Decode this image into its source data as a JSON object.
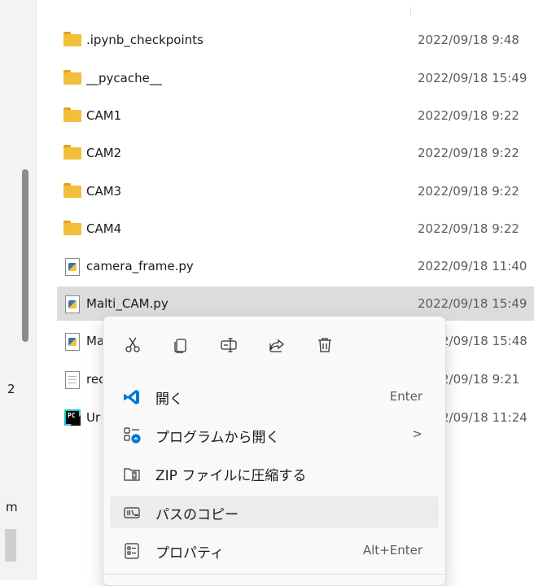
{
  "left_edge": {
    "row_text_a": "2",
    "row_text_b": "m"
  },
  "files": [
    {
      "name": ".ipynb_checkpoints",
      "date": "2022/09/18 9:48",
      "icon": "folder-icon"
    },
    {
      "name": "__pycache__",
      "date": "2022/09/18 15:49",
      "icon": "folder-icon"
    },
    {
      "name": "CAM1",
      "date": "2022/09/18 9:22",
      "icon": "folder-icon"
    },
    {
      "name": "CAM2",
      "date": "2022/09/18 9:22",
      "icon": "folder-icon"
    },
    {
      "name": "CAM3",
      "date": "2022/09/18 9:22",
      "icon": "folder-icon"
    },
    {
      "name": "CAM4",
      "date": "2022/09/18 9:22",
      "icon": "folder-icon"
    },
    {
      "name": "camera_frame.py",
      "date": "2022/09/18 11:40",
      "icon": "python-file-icon"
    },
    {
      "name": "Malti_CAM.py",
      "date": "2022/09/18 15:49",
      "icon": "python-file-icon",
      "selected": true
    },
    {
      "name": "Ma",
      "date": "2/09/18 15:48",
      "icon": "python-file-icon"
    },
    {
      "name": "rec",
      "date": "2/09/18 9:21",
      "icon": "text-file-icon"
    },
    {
      "name": "Ur",
      "date": "2/09/18 11:24",
      "icon": "pycharm-file-icon"
    }
  ],
  "context_menu": {
    "quick_actions": [
      {
        "name": "cut",
        "icon": "scissors-icon"
      },
      {
        "name": "copy",
        "icon": "copy-icon"
      },
      {
        "name": "rename",
        "icon": "rename-icon"
      },
      {
        "name": "share",
        "icon": "share-icon"
      },
      {
        "name": "delete",
        "icon": "trash-icon"
      }
    ],
    "items": [
      {
        "label": "開く",
        "shortcut": "Enter",
        "icon": "vscode-icon"
      },
      {
        "label": "プログラムから開く",
        "chevron": ">",
        "icon": "open-with-icon"
      },
      {
        "label": "ZIP ファイルに圧縮する",
        "icon": "zip-folder-icon"
      },
      {
        "label": "パスのコピー",
        "icon": "copy-path-icon",
        "hovered": true
      },
      {
        "label": "プロパティ",
        "shortcut": "Alt+Enter",
        "icon": "properties-icon"
      }
    ]
  },
  "colors": {
    "folder": "#f3be3a",
    "selected_row": "#dcdcdc",
    "menu_bg": "#f9f9f9",
    "vscode_blue": "#0078d4"
  }
}
